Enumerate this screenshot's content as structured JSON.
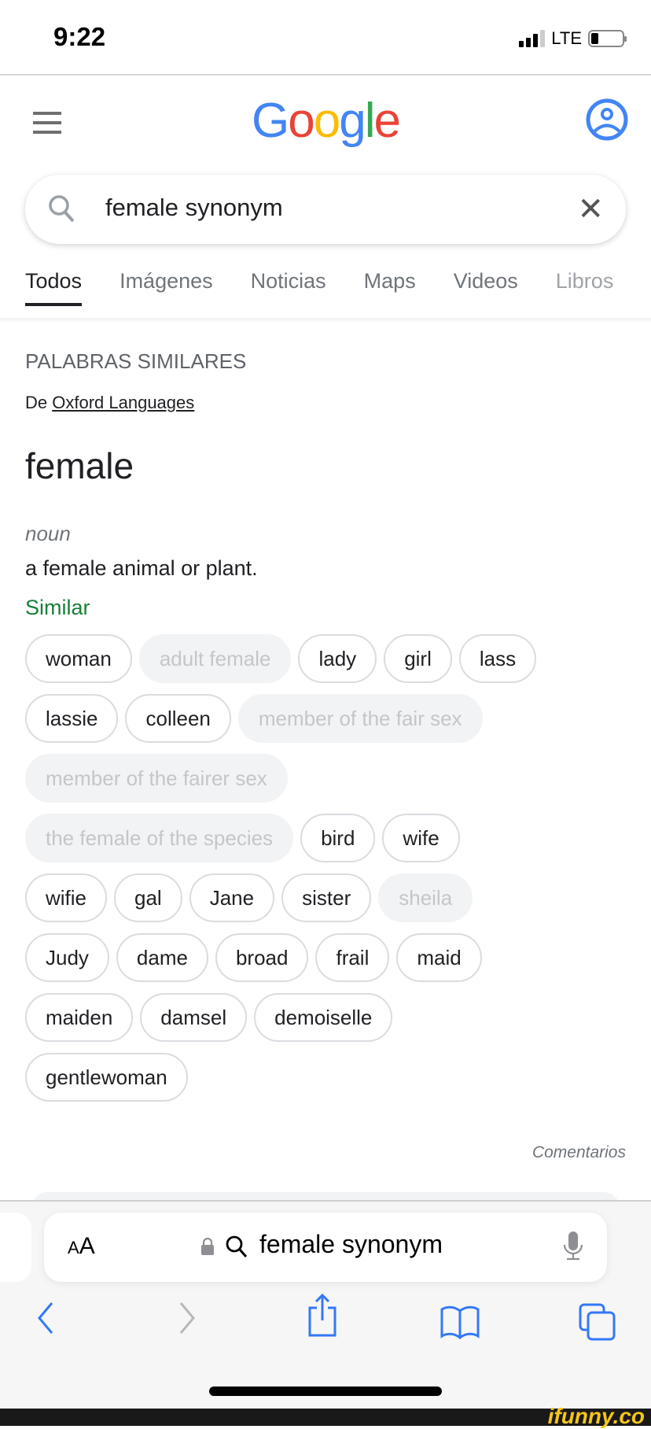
{
  "status_bar": {
    "time": "9:22",
    "network": "LTE",
    "signal_bars": 3,
    "signal_max": 4,
    "battery_level": 0.2
  },
  "header": {
    "logo": "Google",
    "logo_colors": [
      "#4285F4",
      "#EA4335",
      "#FBBC05",
      "#4285F4",
      "#34A853",
      "#EA4335"
    ],
    "menu_icon": "hamburger-icon",
    "account_icon": "account-circle-icon",
    "accent": "#4285F4"
  },
  "search": {
    "value": "female synonym"
  },
  "tabs": [
    {
      "label": "Todos",
      "active": true
    },
    {
      "label": "Imágenes"
    },
    {
      "label": "Noticias"
    },
    {
      "label": "Maps"
    },
    {
      "label": "Videos"
    },
    {
      "label": "Libros"
    }
  ],
  "result": {
    "section_title": "PALABRAS SIMILARES",
    "source_prefix": "De",
    "source_link": "Oxford Languages",
    "word": "female",
    "part_of_speech": "noun",
    "definition": "a female animal or plant.",
    "similar_label": "Similar",
    "synonyms": [
      {
        "label": "woman"
      },
      {
        "label": "adult female",
        "disabled": true
      },
      {
        "label": "lady"
      },
      {
        "label": "girl"
      },
      {
        "label": "lass"
      },
      {
        "label": "lassie"
      },
      {
        "label": "colleen"
      },
      {
        "label": "member of the fair sex",
        "disabled": true
      },
      {
        "label": "member of the fairer sex",
        "disabled": true
      },
      {
        "label": "the female of the species",
        "disabled": true
      },
      {
        "label": "bird"
      },
      {
        "label": "wife"
      },
      {
        "label": "wifie"
      },
      {
        "label": "gal"
      },
      {
        "label": "Jane"
      },
      {
        "label": "sister"
      },
      {
        "label": "sheila",
        "disabled": true
      },
      {
        "label": "Judy"
      },
      {
        "label": "dame"
      },
      {
        "label": "broad"
      },
      {
        "label": "frail"
      },
      {
        "label": "maid"
      },
      {
        "label": "maiden"
      },
      {
        "label": "damsel"
      },
      {
        "label": "demoiselle"
      },
      {
        "label": "gentlewoman"
      }
    ],
    "feedback": "Comentarios"
  },
  "browser": {
    "aa_small": "A",
    "aa_large": "A",
    "url_text": "female synonym",
    "tint": "#3478F6"
  },
  "watermark": "ifunny.co"
}
